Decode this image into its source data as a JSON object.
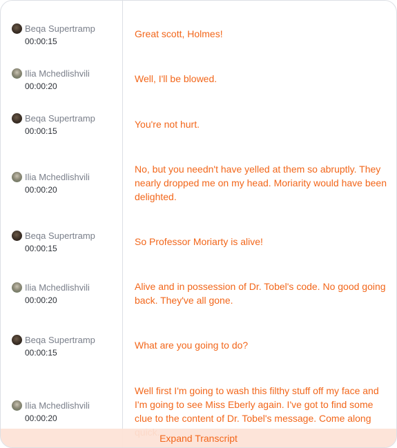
{
  "transcript": [
    {
      "speaker": "Beqa Supertramp",
      "avatar": "beqa",
      "time": "00:00:15",
      "text": "Great scott, Holmes!"
    },
    {
      "speaker": "Ilia Mchedlishvili",
      "avatar": "ilia",
      "time": "00:00:20",
      "text": "Well, I'll be blowed."
    },
    {
      "speaker": "Beqa Supertramp",
      "avatar": "beqa",
      "time": "00:00:15",
      "text": "You're not hurt."
    },
    {
      "speaker": "Ilia Mchedlishvili",
      "avatar": "ilia",
      "time": "00:00:20",
      "text": "No, but you needn't have yelled at them so abruptly. They nearly dropped me on my head. Moriarity would have been delighted."
    },
    {
      "speaker": "Beqa Supertramp",
      "avatar": "beqa",
      "time": "00:00:15",
      "text": "So Professor Moriarty is alive!"
    },
    {
      "speaker": "Ilia Mchedlishvili",
      "avatar": "ilia",
      "time": "00:00:20",
      "text": "Alive and in possession of Dr. Tobel's code. No good going back. They've all gone."
    },
    {
      "speaker": "Beqa Supertramp",
      "avatar": "beqa",
      "time": "00:00:15",
      "text": "What are you going to do?"
    },
    {
      "speaker": "Ilia Mchedlishvili",
      "avatar": "ilia",
      "time": "00:00:20",
      "text": "Well first I'm going to wash this filthy stuff off my face and I'm going to see Miss Eberly again. I've got to find some clue to the content of Dr. Tobel's message. Come along quick."
    }
  ],
  "expand_label": "Expand Transcript",
  "colors": {
    "accent": "#f2661a",
    "expand_bg": "#fde2d6",
    "border": "#dcdfe4"
  }
}
